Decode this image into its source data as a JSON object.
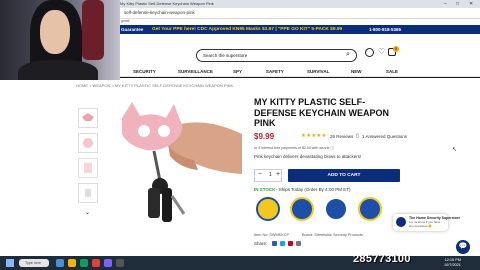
{
  "browser": {
    "tab_title": "My Kitty Plastic Self-Defense Keychain Weapon Pink",
    "url": "self-defense-keychain-weapon-pink",
    "bookmark": "gmail"
  },
  "promo": {
    "left": "Guarantee",
    "middle": "Get Your PPE here! CDC Approved KN95 Masks $3.97 | \"PPE GO KIT\" 5-PACK $9.99",
    "right": "1-800-818-5365"
  },
  "header": {
    "search_placeholder": "Search the superstore",
    "cart_count": "0"
  },
  "nav": [
    "SECURITY",
    "SURVEILLANCE",
    "SPY",
    "SAFETY",
    "SURVIVAL",
    "NEW",
    "SALE"
  ],
  "breadcrumb": "HOME  >  WEAPON  >  MY KITTY PLASTIC SELF-DEFENSE KEYCHAIN WEAPON PINK",
  "product": {
    "title": "MY KITTY PLASTIC SELF-DEFENSE KEYCHAIN WEAPON PINK",
    "price": "$9.99",
    "stars": "★★★★★",
    "rating": 5,
    "reviews": "26 Reviews",
    "answered": "1 Answered Questions",
    "sezzle": "or 4 interest-free payments of $2.50 with sezzle ⓘ",
    "description": "Pink keychain delivers devastating blows to attackers!",
    "quantity": "1",
    "add_to_cart": "ADD TO CART",
    "stock": "IN STOCK",
    "ships": "- Ships Today (Order By 4:00 PM ET)",
    "sku": "Item No: SWMKKCP",
    "brand": "Brand: Streetwise Security Products",
    "share": "Share:"
  },
  "badges": [
    {
      "name": "90-day-badge",
      "color": "#f2c81f"
    },
    {
      "name": "price-match-badge",
      "color": "#1e4fa8"
    },
    {
      "name": "free-shipping-badge",
      "color": "#1e4fa8"
    },
    {
      "name": "guarantee-badge",
      "color": "#1e4fa8"
    }
  ],
  "chat": {
    "title": "The Home Security Superstore",
    "message": "Let us know if you have any questions 😊",
    "button_icon": "💬"
  },
  "taskbar": {
    "search": "Type here",
    "time": "12:15 PM",
    "date": "10/7/2021"
  },
  "counter": "285773100",
  "colors": {
    "brand_navy": "#0c2d7a",
    "price_red": "#c5232c",
    "star_gold": "#f5a800",
    "stock_green": "#2a9d3a"
  }
}
